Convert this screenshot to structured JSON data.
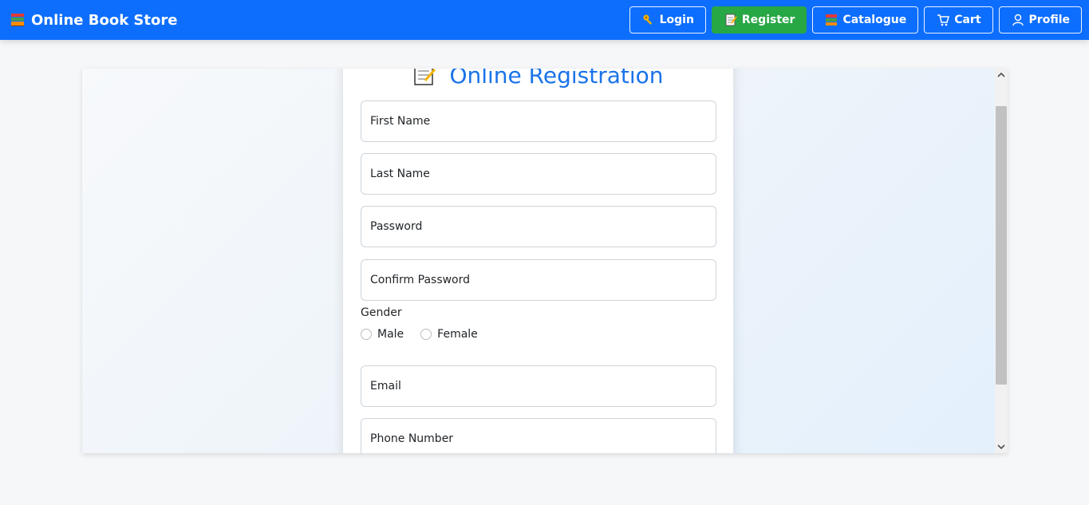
{
  "app": {
    "title": "Online Book Store",
    "icon": "books-icon"
  },
  "nav": [
    {
      "label": "Login",
      "icon": "key-icon",
      "active": false
    },
    {
      "label": "Register",
      "icon": "memo-icon",
      "active": true
    },
    {
      "label": "Catalogue",
      "icon": "books-icon",
      "active": false
    },
    {
      "label": "Cart",
      "icon": "cart-icon",
      "active": false
    },
    {
      "label": "Profile",
      "icon": "user-icon",
      "active": false
    }
  ],
  "form": {
    "title": "Online Registration",
    "title_icon": "memo-icon",
    "first_name_placeholder": "First Name",
    "last_name_placeholder": "Last Name",
    "password_placeholder": "Password",
    "confirm_password_placeholder": "Confirm Password",
    "gender_label": "Gender",
    "gender_options": [
      "Male",
      "Female"
    ],
    "email_placeholder": "Email",
    "phone_placeholder": "Phone Number"
  },
  "colors": {
    "navbar": "#0d6efd",
    "active_button": "#28a745",
    "title": "#1a73e8"
  }
}
